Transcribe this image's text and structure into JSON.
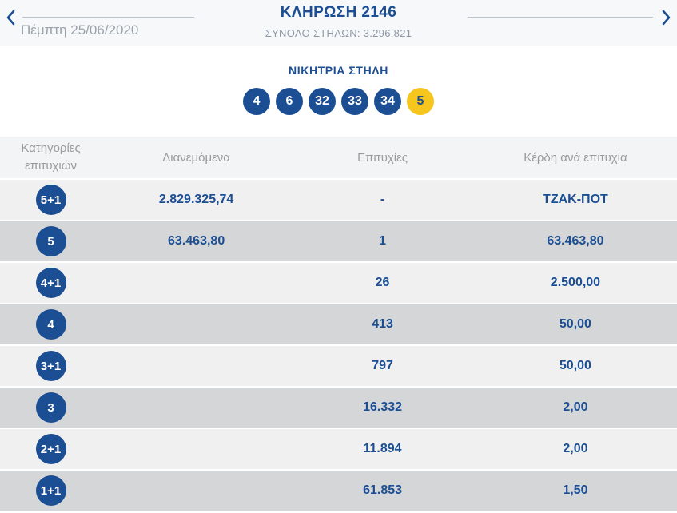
{
  "colors": {
    "primary_blue": "#1b4e92",
    "bonus_yellow": "#f6c51e",
    "row_light": "#f0f0f1",
    "row_dark": "#d5d6d7",
    "header_bg": "#f3f4f5",
    "topbar_bg": "#f7f8fa",
    "muted_gray": "#9b9b9b"
  },
  "top_bar": {
    "date": "Πέμπτη 25/06/2020",
    "title": "ΚΛΗΡΩΣΗ 2146",
    "subtitle": "ΣΥΝΟΛΟ ΣΤΗΛΩΝ: 3.296.821",
    "prev_icon": "chevron-left",
    "next_icon": "chevron-right"
  },
  "winning": {
    "title": "ΝΙΚΗΤΡΙΑ ΣΤΗΛΗ",
    "numbers": [
      {
        "value": "4",
        "type": "main"
      },
      {
        "value": "6",
        "type": "main"
      },
      {
        "value": "32",
        "type": "main"
      },
      {
        "value": "33",
        "type": "main"
      },
      {
        "value": "34",
        "type": "main"
      },
      {
        "value": "5",
        "type": "bonus"
      }
    ]
  },
  "table": {
    "headers": {
      "category": "Κατηγορίες επιτυχιών",
      "distributed": "Διανεμόμενα",
      "winners": "Επιτυχίες",
      "prize": "Κέρδη ανά επιτυχία"
    },
    "rows": [
      {
        "tier": "5+1",
        "distributed": "2.829.325,74",
        "winners": "-",
        "prize": "ΤΖΑΚ-ΠΟΤ"
      },
      {
        "tier": "5",
        "distributed": "63.463,80",
        "winners": "1",
        "prize": "63.463,80"
      },
      {
        "tier": "4+1",
        "distributed": "",
        "winners": "26",
        "prize": "2.500,00"
      },
      {
        "tier": "4",
        "distributed": "",
        "winners": "413",
        "prize": "50,00"
      },
      {
        "tier": "3+1",
        "distributed": "",
        "winners": "797",
        "prize": "50,00"
      },
      {
        "tier": "3",
        "distributed": "",
        "winners": "16.332",
        "prize": "2,00"
      },
      {
        "tier": "2+1",
        "distributed": "",
        "winners": "11.894",
        "prize": "2,00"
      },
      {
        "tier": "1+1",
        "distributed": "",
        "winners": "61.853",
        "prize": "1,50"
      }
    ]
  }
}
